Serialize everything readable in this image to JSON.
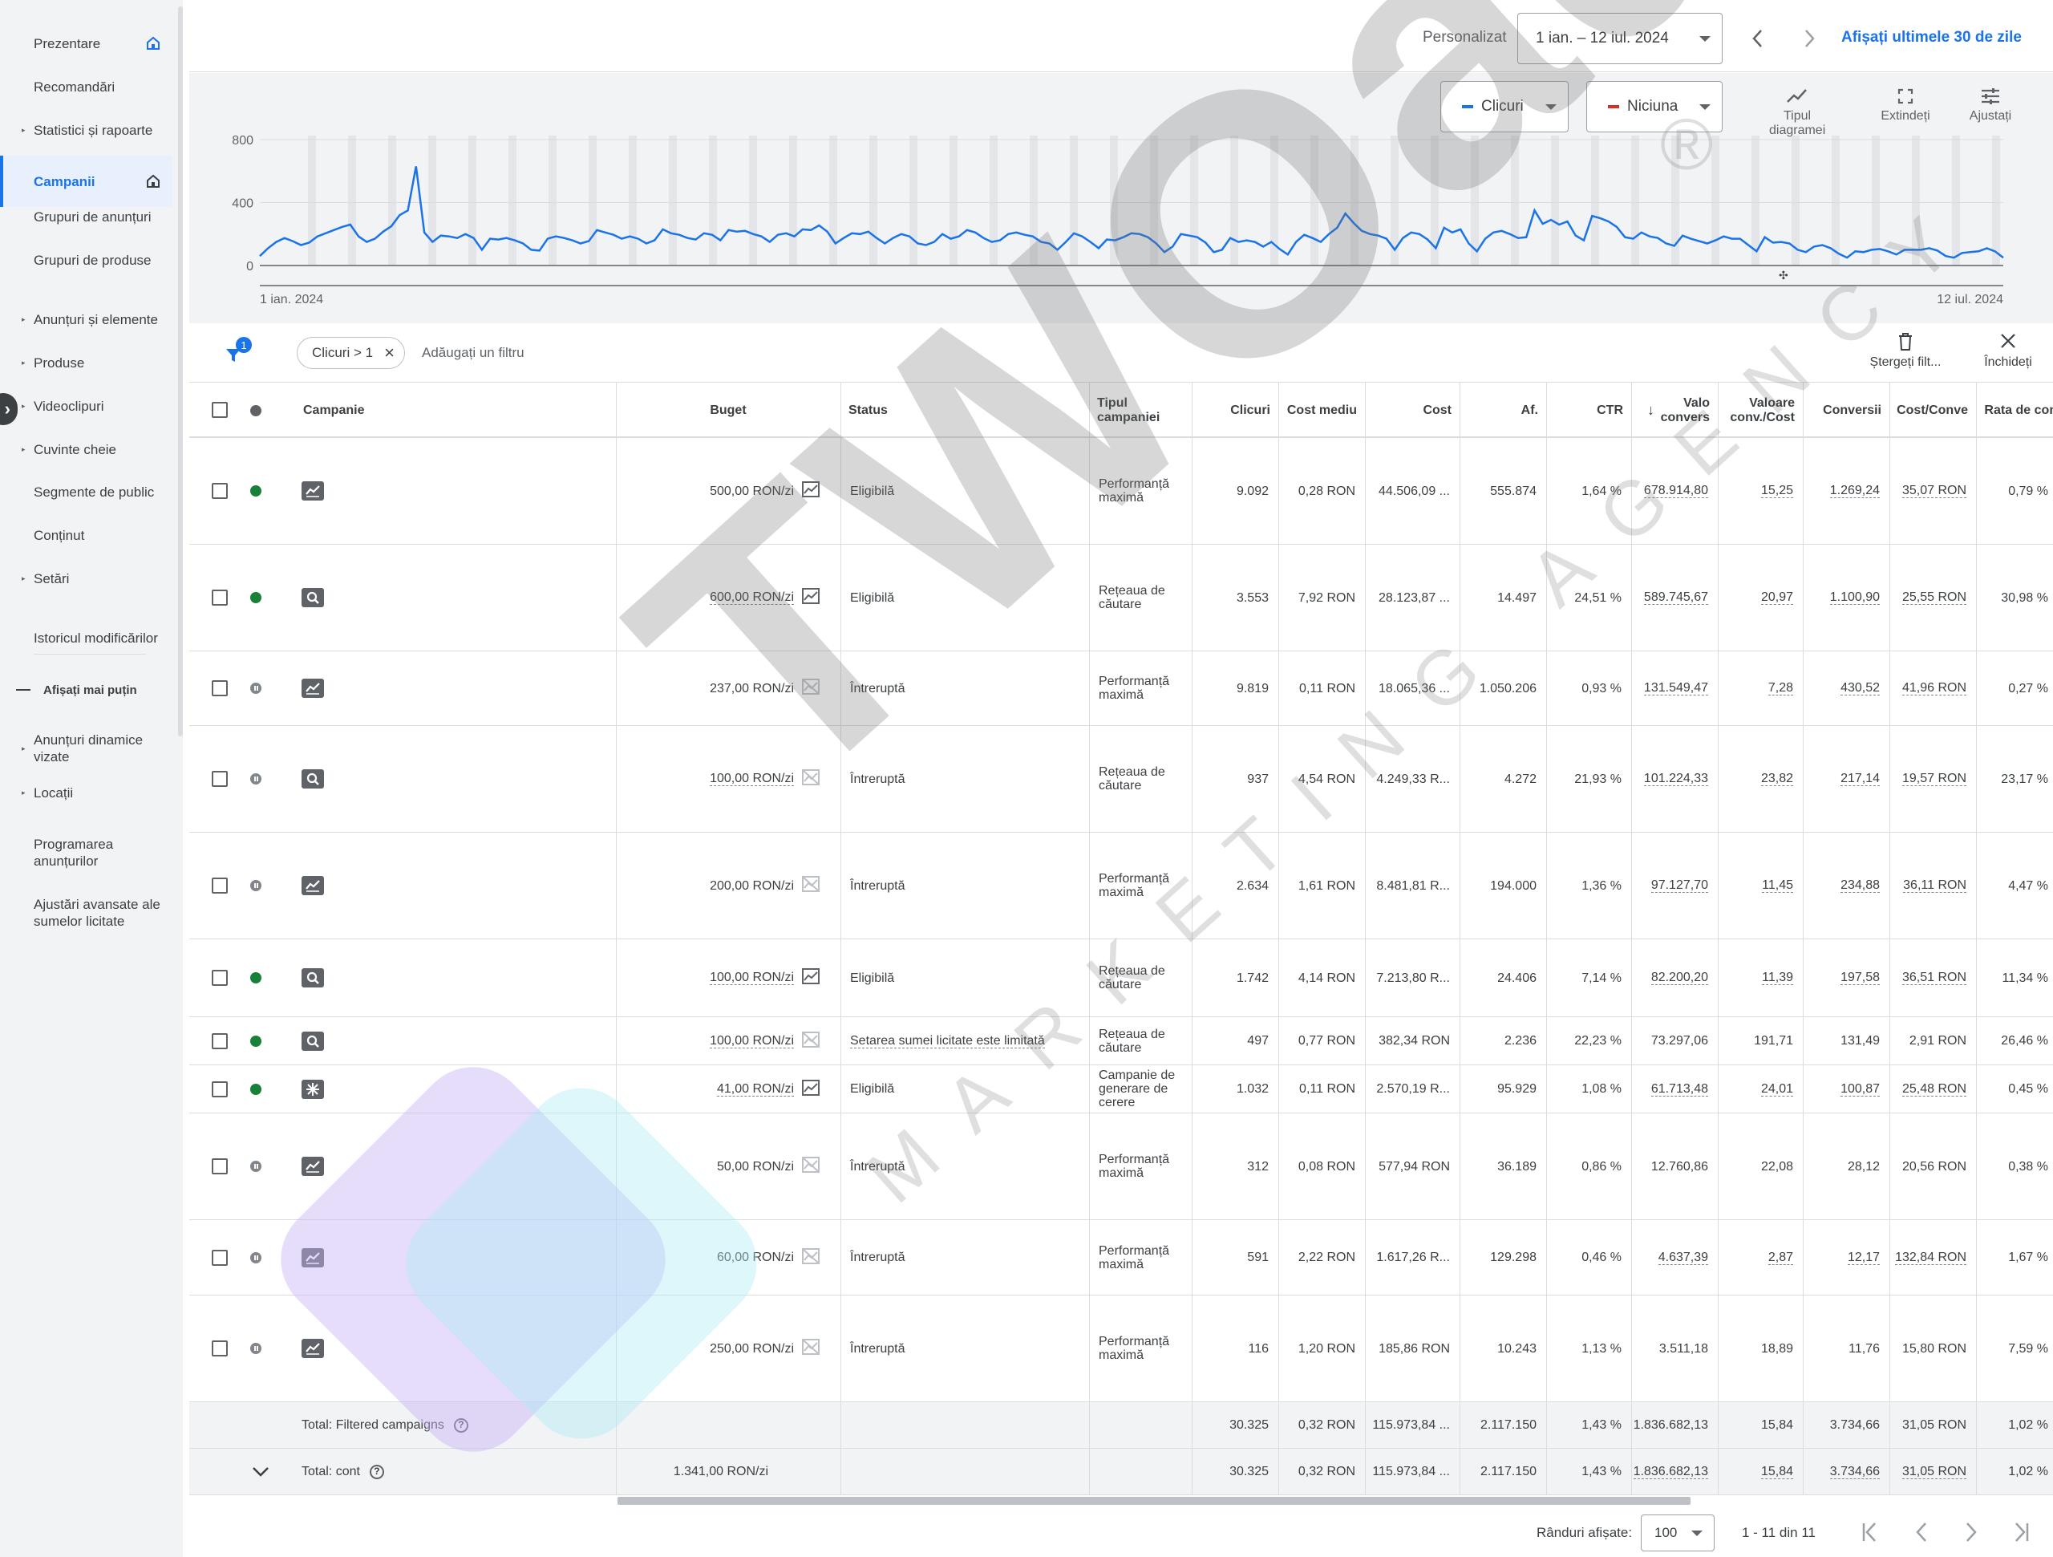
{
  "sidebar": {
    "items": [
      {
        "label": "Prezentare",
        "arrow": false
      },
      {
        "label": "Recomandări",
        "arrow": false
      },
      {
        "label": "Statistici și rapoarte",
        "arrow": true
      },
      {
        "label": "Campanii",
        "arrow": false,
        "active": true
      },
      {
        "label": "Grupuri de anunțuri",
        "arrow": false
      },
      {
        "label": "Grupuri de produse",
        "arrow": false
      },
      {
        "label": "Anunțuri și elemente",
        "arrow": true
      },
      {
        "label": "Produse",
        "arrow": true
      },
      {
        "label": "Videoclipuri",
        "arrow": true
      },
      {
        "label": "Cuvinte cheie",
        "arrow": true
      },
      {
        "label": "Segmente de public",
        "arrow": false
      },
      {
        "label": "Conținut",
        "arrow": false
      },
      {
        "label": "Setări",
        "arrow": true
      },
      {
        "label": "Istoricul modificărilor",
        "arrow": false
      },
      {
        "label": "Afișați mai puțin",
        "arrow": false
      },
      {
        "label": "Anunțuri dinamice vizate",
        "arrow": true
      },
      {
        "label": "Locații",
        "arrow": true
      },
      {
        "label": "Programarea anunțurilor",
        "arrow": false
      },
      {
        "label": "Ajustări avansate ale sumelor licitate",
        "arrow": false
      }
    ]
  },
  "topbar": {
    "custom_label": "Personalizat",
    "date_range": "1 ian. – 12 iul. 2024",
    "last30_link": "Afișați ultimele 30 de zile"
  },
  "chart_controls": {
    "metric1": "Clicuri",
    "metric1_color": "#1a73e8",
    "metric2": "Niciuna",
    "metric2_color": "#d93025",
    "tool_chart_type": "Tipul diagramei",
    "tool_expand": "Extindeți",
    "tool_adjust": "Ajustați"
  },
  "chart_data": {
    "type": "line",
    "x_start_label": "1 ian. 2024",
    "x_end_label": "12 iul. 2024",
    "yticks": [
      "800",
      "400",
      "0"
    ],
    "ylim": [
      0,
      800
    ],
    "series": [
      {
        "name": "Clicuri",
        "color": "#1a73e8",
        "values": [
          60,
          110,
          150,
          175,
          155,
          130,
          145,
          185,
          205,
          225,
          245,
          260,
          185,
          150,
          170,
          215,
          250,
          320,
          350,
          630,
          210,
          150,
          190,
          185,
          175,
          200,
          175,
          100,
          170,
          165,
          175,
          160,
          140,
          100,
          95,
          170,
          185,
          175,
          160,
          140,
          155,
          225,
          210,
          195,
          170,
          185,
          170,
          140,
          160,
          230,
          205,
          195,
          175,
          165,
          205,
          195,
          160,
          225,
          215,
          220,
          200,
          185,
          150,
          195,
          205,
          185,
          230,
          225,
          255,
          215,
          140,
          175,
          205,
          200,
          215,
          175,
          140,
          175,
          200,
          185,
          140,
          130,
          150,
          200,
          170,
          185,
          225,
          210,
          175,
          150,
          160,
          200,
          210,
          195,
          185,
          150,
          140,
          100,
          150,
          205,
          185,
          150,
          110,
          165,
          160,
          180,
          205,
          200,
          180,
          140,
          85,
          120,
          200,
          190,
          180,
          145,
          85,
          100,
          175,
          150,
          160,
          150,
          120,
          150,
          105,
          70,
          150,
          195,
          175,
          150,
          200,
          240,
          330,
          270,
          220,
          200,
          190,
          170,
          100,
          175,
          210,
          200,
          165,
          110,
          240,
          210,
          230,
          140,
          90,
          170,
          210,
          220,
          200,
          175,
          180,
          350,
          265,
          290,
          260,
          280,
          190,
          160,
          315,
          300,
          280,
          245,
          180,
          170,
          210,
          185,
          175,
          140,
          125,
          190,
          170,
          155,
          140,
          160,
          185,
          170,
          170,
          130,
          90,
          180,
          145,
          150,
          140,
          100,
          85,
          120,
          130,
          110,
          75,
          50,
          90,
          85,
          100,
          105,
          90,
          70,
          100,
          100,
          100,
          110,
          95,
          60,
          50,
          80,
          85,
          90,
          110,
          90,
          50
        ]
      }
    ]
  },
  "filter": {
    "badge": "1",
    "chip": "Clicuri > 1",
    "add_filter": "Adăugați un filtru",
    "delete_label": "Ștergeți filt...",
    "close_label": "Închideți"
  },
  "table": {
    "headers": {
      "campaign": "Campanie",
      "budget": "Buget",
      "status": "Status",
      "type": "Tipul campaniei",
      "clicks": "Clicuri",
      "avgcost": "Cost mediu",
      "cost": "Cost",
      "impr": "Af.",
      "ctr": "CTR",
      "convval": "Valo convers",
      "valcost": "Valoare conv./Cost",
      "conv": "Conversii",
      "costconv": "Cost/Conve",
      "rate": "Rata de conv"
    },
    "rows": [
      {
        "status_dot": "on",
        "icon": "performance-max-icon",
        "budget": "500,00 RON/zi",
        "budget_dash": false,
        "chart_ok": true,
        "status": "Eligibilă",
        "status_dash": false,
        "type": "Performanță maximă",
        "clicks": "9.092",
        "avgcost": "0,28 RON",
        "cost": "44.506,09 ...",
        "impr": "555.874",
        "ctr": "1,64 %",
        "convval": "678.914,80",
        "valcost": "15,25",
        "conv": "1.269,24",
        "costconv": "35,07 RON",
        "rate": "0,79 %",
        "dash": true
      },
      {
        "status_dot": "on",
        "icon": "search-icon",
        "budget": "600,00 RON/zi",
        "budget_dash": true,
        "chart_ok": true,
        "status": "Eligibilă",
        "status_dash": false,
        "type": "Rețeaua de căutare",
        "clicks": "3.553",
        "avgcost": "7,92 RON",
        "cost": "28.123,87 ...",
        "impr": "14.497",
        "ctr": "24,51 %",
        "convval": "589.745,67",
        "valcost": "20,97",
        "conv": "1.100,90",
        "costconv": "25,55 RON",
        "rate": "30,98 %",
        "dash": true
      },
      {
        "status_dot": "off",
        "icon": "performance-max-icon",
        "budget": "237,00 RON/zi",
        "budget_dash": false,
        "chart_ok": false,
        "status": "Întreruptă",
        "status_dash": false,
        "type": "Performanță maximă",
        "clicks": "9.819",
        "avgcost": "0,11 RON",
        "cost": "18.065,36 ...",
        "impr": "1.050.206",
        "ctr": "0,93 %",
        "convval": "131.549,47",
        "valcost": "7,28",
        "conv": "430,52",
        "costconv": "41,96 RON",
        "rate": "0,27 %",
        "dash": true
      },
      {
        "status_dot": "off",
        "icon": "search-icon",
        "budget": "100,00 RON/zi",
        "budget_dash": true,
        "chart_ok": false,
        "status": "Întreruptă",
        "status_dash": false,
        "type": "Rețeaua de căutare",
        "clicks": "937",
        "avgcost": "4,54 RON",
        "cost": "4.249,33 R...",
        "impr": "4.272",
        "ctr": "21,93 %",
        "convval": "101.224,33",
        "valcost": "23,82",
        "conv": "217,14",
        "costconv": "19,57 RON",
        "rate": "23,17 %",
        "dash": true
      },
      {
        "status_dot": "off",
        "icon": "performance-max-icon",
        "budget": "200,00 RON/zi",
        "budget_dash": false,
        "chart_ok": false,
        "status": "Întreruptă",
        "status_dash": false,
        "type": "Performanță maximă",
        "clicks": "2.634",
        "avgcost": "1,61 RON",
        "cost": "8.481,81 R...",
        "impr": "194.000",
        "ctr": "1,36 %",
        "convval": "97.127,70",
        "valcost": "11,45",
        "conv": "234,88",
        "costconv": "36,11 RON",
        "rate": "4,47 %",
        "dash": true
      },
      {
        "status_dot": "on",
        "icon": "search-icon",
        "budget": "100,00 RON/zi",
        "budget_dash": true,
        "chart_ok": true,
        "status": "Eligibilă",
        "status_dash": false,
        "type": "Rețeaua de căutare",
        "clicks": "1.742",
        "avgcost": "4,14 RON",
        "cost": "7.213,80 R...",
        "impr": "24.406",
        "ctr": "7,14 %",
        "convval": "82.200,20",
        "valcost": "11,39",
        "conv": "197,58",
        "costconv": "36,51 RON",
        "rate": "11,34 %",
        "dash": true
      },
      {
        "status_dot": "on",
        "icon": "search-icon",
        "budget": "100,00 RON/zi",
        "budget_dash": true,
        "chart_ok": false,
        "status": "Setarea sumei licitate este limitată",
        "status_dash": true,
        "type": "Rețeaua de căutare",
        "clicks": "497",
        "avgcost": "0,77 RON",
        "cost": "382,34 RON",
        "impr": "2.236",
        "ctr": "22,23 %",
        "convval": "73.297,06",
        "valcost": "191,71",
        "conv": "131,49",
        "costconv": "2,91 RON",
        "rate": "26,46 %",
        "dash": false
      },
      {
        "status_dot": "on",
        "icon": "demand-gen-icon",
        "budget": "41,00 RON/zi",
        "budget_dash": true,
        "chart_ok": true,
        "status": "Eligibilă",
        "status_dash": false,
        "type": "Campanie de generare de cerere",
        "clicks": "1.032",
        "avgcost": "0,11 RON",
        "cost": "2.570,19 R...",
        "impr": "95.929",
        "ctr": "1,08 %",
        "convval": "61.713,48",
        "valcost": "24,01",
        "conv": "100,87",
        "costconv": "25,48 RON",
        "rate": "0,45 %",
        "dash": true
      },
      {
        "status_dot": "off",
        "icon": "performance-max-icon",
        "budget": "50,00 RON/zi",
        "budget_dash": false,
        "chart_ok": false,
        "status": "Întreruptă",
        "status_dash": false,
        "type": "Performanță maximă",
        "clicks": "312",
        "avgcost": "0,08 RON",
        "cost": "577,94 RON",
        "impr": "36.189",
        "ctr": "0,86 %",
        "convval": "12.760,86",
        "valcost": "22,08",
        "conv": "28,12",
        "costconv": "20,56 RON",
        "rate": "0,38 %",
        "dash": false
      },
      {
        "status_dot": "off",
        "icon": "performance-max-icon",
        "budget": "60,00 RON/zi",
        "budget_dash": false,
        "chart_ok": false,
        "status": "Întreruptă",
        "status_dash": false,
        "type": "Performanță maximă",
        "clicks": "591",
        "avgcost": "2,22 RON",
        "cost": "1.617,26 R...",
        "impr": "129.298",
        "ctr": "0,46 %",
        "convval": "4.637,39",
        "valcost": "2,87",
        "conv": "12,17",
        "costconv": "132,84 RON",
        "rate": "1,67 %",
        "dash": true
      },
      {
        "status_dot": "off",
        "icon": "performance-max-icon",
        "budget": "250,00 RON/zi",
        "budget_dash": false,
        "chart_ok": false,
        "status": "Întreruptă",
        "status_dash": false,
        "type": "Performanță maximă",
        "clicks": "116",
        "avgcost": "1,20 RON",
        "cost": "185,86 RON",
        "impr": "10.243",
        "ctr": "1,13 %",
        "convval": "3.511,18",
        "valcost": "18,89",
        "conv": "11,76",
        "costconv": "15,80 RON",
        "rate": "7,59 %",
        "dash": false
      }
    ],
    "totals": [
      {
        "label": "Total: Filtered campaigns",
        "budget": "",
        "clicks": "30.325",
        "avgcost": "0,32 RON",
        "cost": "115.973,84 ...",
        "impr": "2.117.150",
        "ctr": "1,43 %",
        "convval": "1.836.682,13",
        "valcost": "15,84",
        "conv": "3.734,66",
        "costconv": "31,05 RON",
        "rate": "1,02 %",
        "dash": false
      },
      {
        "label": "Total: cont",
        "budget": "1.341,00 RON/zi",
        "clicks": "30.325",
        "avgcost": "0,32 RON",
        "cost": "115.973,84 ...",
        "impr": "2.117.150",
        "ctr": "1,43 %",
        "convval": "1.836.682,13",
        "valcost": "15,84",
        "conv": "3.734,66",
        "costconv": "31,05 RON",
        "rate": "1,02 %",
        "dash": true
      }
    ]
  },
  "footer": {
    "rows_label": "Rânduri afișate:",
    "rows_value": "100",
    "range": "1 - 11 din 11"
  },
  "watermark": {
    "big": "TWOads",
    "small": "MARKETING AGENCY",
    "reg": "®"
  }
}
